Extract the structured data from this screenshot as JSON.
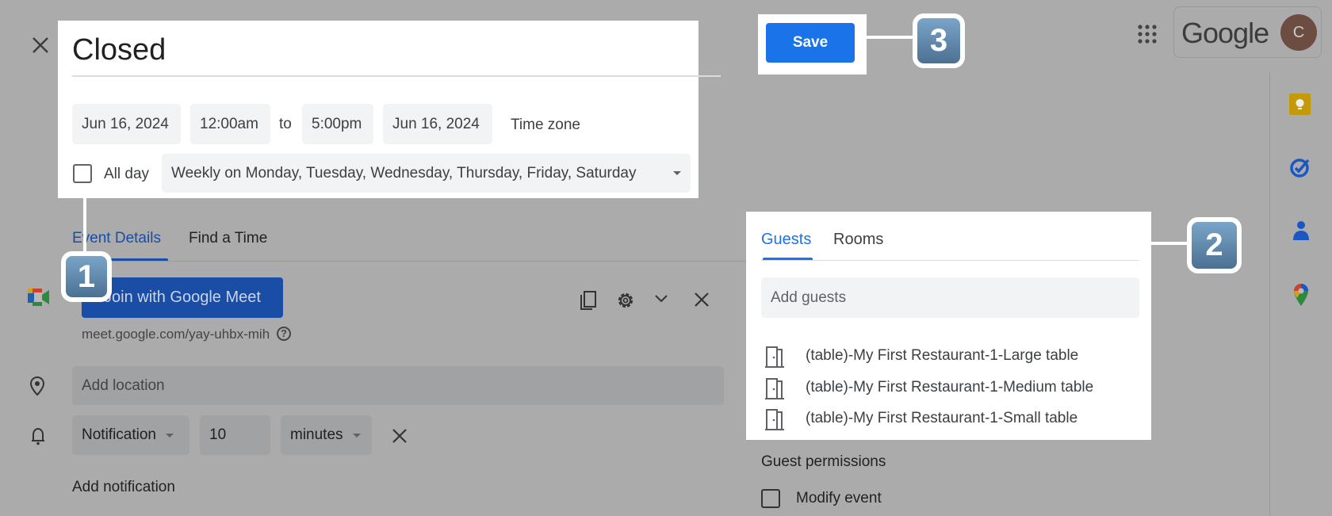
{
  "header": {
    "close_icon": "close-icon",
    "title": "Closed",
    "save_label": "Save",
    "apps_icon": "apps-grid-icon",
    "brand": "Google",
    "avatar_initial": "C",
    "avatar_color": "#6d4c41"
  },
  "datetime": {
    "start_date": "Jun 16, 2024",
    "start_time": "12:00am",
    "to": "to",
    "end_time": "5:00pm",
    "end_date": "Jun 16, 2024",
    "time_zone": "Time zone",
    "all_day_label": "All day",
    "all_day_checked": false,
    "recurrence": "Weekly on Monday, Tuesday, Wednesday, Thursday, Friday, Saturday"
  },
  "tabs": [
    {
      "label": "Event Details",
      "active": true
    },
    {
      "label": "Find a Time",
      "active": false
    }
  ],
  "meet": {
    "join_label": "Join with Google Meet",
    "link": "meet.google.com/yay-uhbx-mih"
  },
  "location": {
    "placeholder": "Add location"
  },
  "notification": {
    "type": "Notification",
    "value": "10",
    "unit": "minutes",
    "add_label": "Add notification"
  },
  "guests_panel": {
    "tabs": [
      {
        "label": "Guests",
        "active": true
      },
      {
        "label": "Rooms",
        "active": false
      }
    ],
    "add_placeholder": "Add guests",
    "rooms": [
      "(table)-My First Restaurant-1-Large table",
      "(table)-My First Restaurant-1-Medium table",
      "(table)-My First Restaurant-1-Small table"
    ],
    "permissions_title": "Guest permissions",
    "modify_event_label": "Modify event",
    "modify_event_checked": false
  },
  "callouts": [
    "1",
    "2",
    "3"
  ],
  "side_panel": [
    "keep-icon",
    "tasks-icon",
    "contacts-icon",
    "maps-icon"
  ],
  "colors": {
    "accent": "#1a73e8",
    "overlay": "#ababab",
    "callout": "#5b84a6"
  }
}
